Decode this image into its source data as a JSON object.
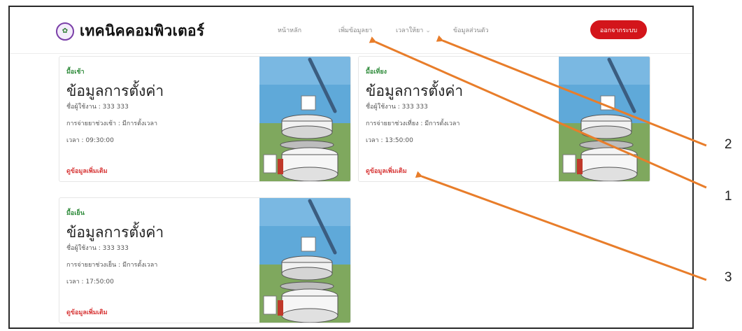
{
  "brand": {
    "name": "เทคนิคคอมพิวเตอร์",
    "icon": "leaf-logo-icon"
  },
  "nav": {
    "home": "หน้าหลัก",
    "add_data": "เพิ่มข้อมูลยา",
    "time": "เวลาให้ยา",
    "personal": "ข้อมูลส่วนตัว",
    "logout": "ออกจากระบบ"
  },
  "cards": [
    {
      "tag": "มื้อเช้า",
      "title": "ข้อมูลการตั้งค่า",
      "user": "ชื่อผู้ใช้งาน : 333 333",
      "schedule": "การจ่ายยาช่วงเช้า : มีการตั้งเวลา",
      "time": "เวลา : 09:30:00",
      "link": "ดูข้อมูลเพิ่มเติม"
    },
    {
      "tag": "มื้อเที่ยง",
      "title": "ข้อมูลการตั้งค่า",
      "user": "ชื่อผู้ใช้งาน : 333 333",
      "schedule": "การจ่ายยาช่วงเที่ยง : มีการตั้งเวลา",
      "time": "เวลา : 13:50:00",
      "link": "ดูข้อมูลเพิ่มเติม"
    },
    {
      "tag": "มื้อเย็น",
      "title": "ข้อมูลการตั้งค่า",
      "user": "ชื่อผู้ใช้งาน : 333 333",
      "schedule": "การจ่ายยาช่วงเย็น : มีการตั้งเวลา",
      "time": "เวลา : 17:50:00",
      "link": "ดูข้อมูลเพิ่มเติม"
    }
  ],
  "callouts": {
    "one": "1",
    "two": "2",
    "three": "3"
  },
  "colors": {
    "accent_red": "#d3151b",
    "tag_green": "#2e8b3a",
    "arrow_orange": "#e87d2a"
  }
}
